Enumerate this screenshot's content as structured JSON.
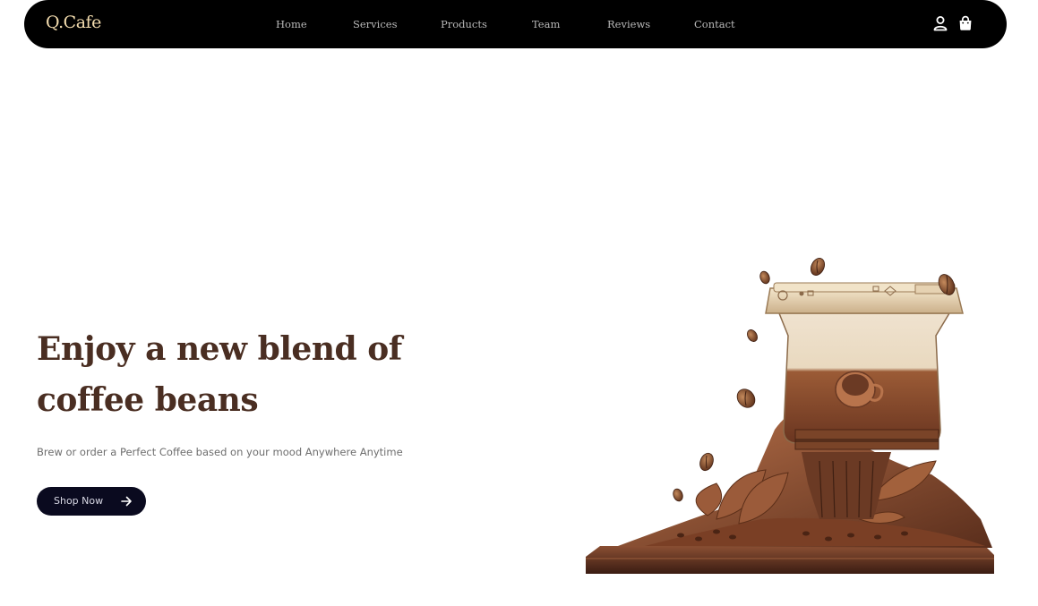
{
  "brand": {
    "logo": "Q.Cafe"
  },
  "nav": {
    "items": [
      {
        "label": "Home"
      },
      {
        "label": "Services"
      },
      {
        "label": "Products"
      },
      {
        "label": "Team"
      },
      {
        "label": "Reviews"
      },
      {
        "label": "Contact"
      }
    ],
    "icons": [
      "user-icon",
      "shopping-bag-icon"
    ]
  },
  "hero": {
    "title_line1": "Enjoy a new blend of",
    "title_line2": "coffee beans",
    "subtitle": "Brew or order a Perfect Coffee based on your mood Anywhere Anytime",
    "cta_label": "Shop Now",
    "cta_icon": "arrow-right-icon",
    "image": "coffee-grinder-illustration"
  },
  "colors": {
    "nav_bg": "#000000",
    "logo": "#f3dcae",
    "nav_link": "#b9b9b9",
    "title": "#4a2e22",
    "subtitle": "#6e6e6e",
    "button_bg": "#0a0a1f",
    "button_text": "#d8d8e4"
  }
}
